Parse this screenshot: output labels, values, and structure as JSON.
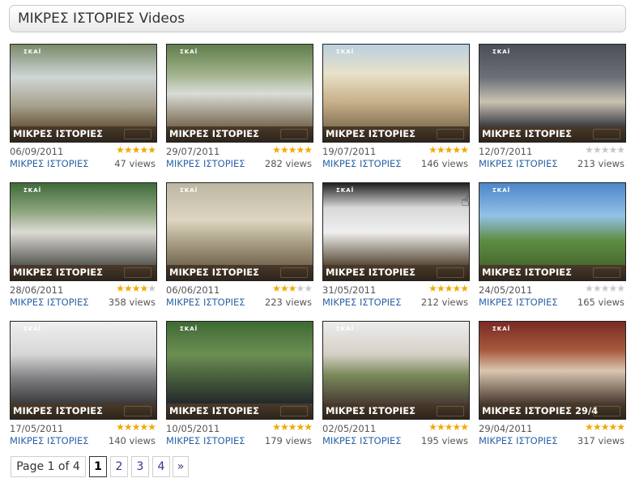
{
  "header": {
    "title": "ΜΙΚΡΕΣ ΙΣΤΟΡΙΕΣ Videos"
  },
  "videos": [
    {
      "caption": "ΜΙΚΡΕΣ ΙΣΤΟΡΙΕΣ",
      "date": "06/09/2011",
      "channel": "ΜΙΚΡΕΣ ΙΣΤΟΡΙΕΣ",
      "views": "47 views",
      "rating": 5
    },
    {
      "caption": "ΜΙΚΡΕΣ ΙΣΤΟΡΙΕΣ",
      "date": "29/07/2011",
      "channel": "ΜΙΚΡΕΣ ΙΣΤΟΡΙΕΣ",
      "views": "282 views",
      "rating": 5
    },
    {
      "caption": "ΜΙΚΡΕΣ ΙΣΤΟΡΙΕΣ",
      "date": "19/07/2011",
      "channel": "ΜΙΚΡΕΣ ΙΣΤΟΡΙΕΣ",
      "views": "146 views",
      "rating": 5
    },
    {
      "caption": "ΜΙΚΡΕΣ ΙΣΤΟΡΙΕΣ",
      "date": "12/07/2011",
      "channel": "ΜΙΚΡΕΣ ΙΣΤΟΡΙΕΣ",
      "views": "213 views",
      "rating": 0
    },
    {
      "caption": "ΜΙΚΡΕΣ ΙΣΤΟΡΙΕΣ",
      "date": "28/06/2011",
      "channel": "ΜΙΚΡΕΣ ΙΣΤΟΡΙΕΣ",
      "views": "358 views",
      "rating": 4
    },
    {
      "caption": "ΜΙΚΡΕΣ ΙΣΤΟΡΙΕΣ",
      "date": "06/06/2011",
      "channel": "ΜΙΚΡΕΣ ΙΣΤΟΡΙΕΣ",
      "views": "223 views",
      "rating": 3
    },
    {
      "caption": "ΜΙΚΡΕΣ ΙΣΤΟΡΙΕΣ",
      "date": "31/05/2011",
      "channel": "ΜΙΚΡΕΣ ΙΣΤΟΡΙΕΣ",
      "views": "212 views",
      "rating": 5
    },
    {
      "caption": "ΜΙΚΡΕΣ ΙΣΤΟΡΙΕΣ",
      "date": "24/05/2011",
      "channel": "ΜΙΚΡΕΣ ΙΣΤΟΡΙΕΣ",
      "views": "165 views",
      "rating": 0
    },
    {
      "caption": "ΜΙΚΡΕΣ ΙΣΤΟΡΙΕΣ",
      "date": "17/05/2011",
      "channel": "ΜΙΚΡΕΣ ΙΣΤΟΡΙΕΣ",
      "views": "140 views",
      "rating": 5
    },
    {
      "caption": "ΜΙΚΡΕΣ ΙΣΤΟΡΙΕΣ",
      "date": "10/05/2011",
      "channel": "ΜΙΚΡΕΣ ΙΣΤΟΡΙΕΣ",
      "views": "179 views",
      "rating": 5
    },
    {
      "caption": "ΜΙΚΡΕΣ ΙΣΤΟΡΙΕΣ",
      "date": "02/05/2011",
      "channel": "ΜΙΚΡΕΣ ΙΣΤΟΡΙΕΣ",
      "views": "195 views",
      "rating": 5
    },
    {
      "caption": "ΜΙΚΡΕΣ ΙΣΤΟΡΙΕΣ 29/4",
      "date": "29/04/2011",
      "channel": "ΜΙΚΡΕΣ ΙΣΤΟΡΙΕΣ",
      "views": "317 views",
      "rating": 5
    }
  ],
  "pagination": {
    "label": "Page 1 of 4",
    "current": "1",
    "pages": [
      "2",
      "3",
      "4"
    ],
    "next": "»"
  },
  "channel_logo": "ΣΚΑΪ",
  "colors": {
    "link": "#2a62a8",
    "star": "#f2a900",
    "caption_bg": "#3a2e22"
  }
}
